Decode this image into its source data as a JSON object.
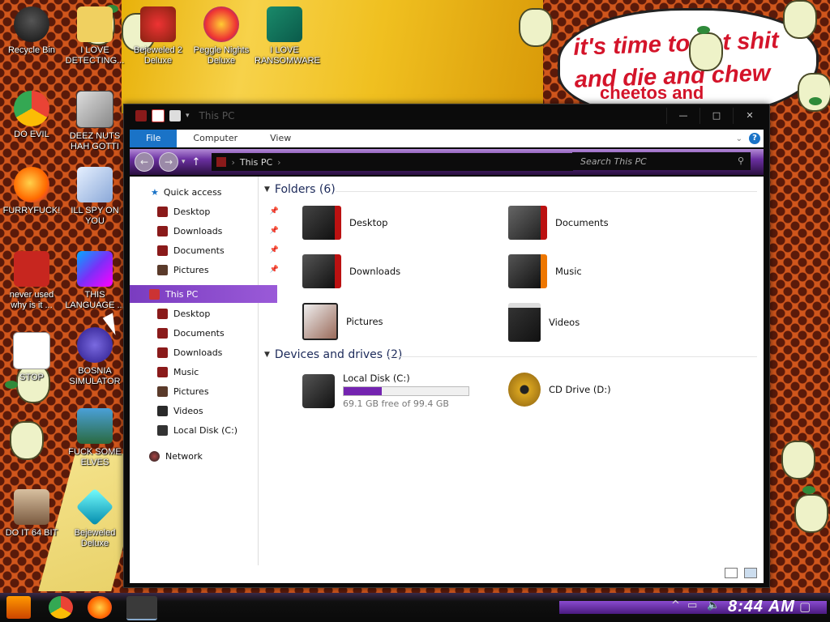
{
  "wallpaper": {
    "speech_line1": "it's time to eat shit",
    "speech_line2": "and die and chew",
    "speech_line3": "cheetos and"
  },
  "desktop_icons": [
    {
      "label": "Recycle Bin",
      "icon": "recycle-bin-icon"
    },
    {
      "label": "I LOVE DETECTING...",
      "icon": "detector-icon"
    },
    {
      "label": "Bejeweled 2 Deluxe",
      "icon": "bejeweled2-icon"
    },
    {
      "label": "Peggle Nights Deluxe",
      "icon": "peggle-icon"
    },
    {
      "label": "I LOVE RANSOMWARE",
      "icon": "publisher-icon"
    },
    {
      "label": "DO EVIL",
      "icon": "chrome-icon"
    },
    {
      "label": "DEEZ NUTS HAH GOTTI",
      "icon": "windows-stack-icon"
    },
    {
      "label": "FURRYFUCK!",
      "icon": "firefox-icon"
    },
    {
      "label": "ILL SPY ON YOU",
      "icon": "network-spy-icon"
    },
    {
      "label": "never used why is it ...",
      "icon": "devcpp-icon"
    },
    {
      "label": "THIS LANGUAGE ...",
      "icon": "goland-icon"
    },
    {
      "label": "STOP",
      "icon": "hxd-icon"
    },
    {
      "label": "BOSNIA SIMULATOR",
      "icon": "mine-icon"
    },
    {
      "label": "FUCK SOME ELVES",
      "icon": "game-elf-icon"
    },
    {
      "label": "DO IT 64 BIT",
      "icon": "64bit-portrait-icon"
    },
    {
      "label": "Bejeweled Deluxe",
      "icon": "diamond-icon"
    }
  ],
  "explorer": {
    "title": "This PC",
    "window_buttons": {
      "minimize": "—",
      "maximize": "□",
      "close": "✕"
    },
    "ribbon_tabs": [
      "File",
      "Computer",
      "View"
    ],
    "address": "This PC",
    "search_placeholder": "Search This PC",
    "nav": {
      "quick_access": "Quick access",
      "quick_items": [
        "Desktop",
        "Downloads",
        "Documents",
        "Pictures"
      ],
      "this_pc": "This PC",
      "pc_items": [
        "Desktop",
        "Documents",
        "Downloads",
        "Music",
        "Pictures",
        "Videos",
        "Local Disk (C:)"
      ],
      "network": "Network"
    },
    "folders_header": "Folders (6)",
    "folders": [
      "Desktop",
      "Documents",
      "Downloads",
      "Music",
      "Pictures",
      "Videos"
    ],
    "devices_header": "Devices and drives (2)",
    "drives": [
      {
        "name": "Local Disk (C:)",
        "free": "69.1 GB free of 99.4 GB",
        "used_fraction": 0.305
      },
      {
        "name": "CD Drive (D:)"
      }
    ]
  },
  "taskbar": {
    "clock": "8:44 AM",
    "apps": [
      "start-icon",
      "chrome-icon",
      "firefox-icon",
      "file-explorer-icon"
    ]
  },
  "colors": {
    "accent": "#7424b0",
    "file_tab": "#1a73c7"
  }
}
